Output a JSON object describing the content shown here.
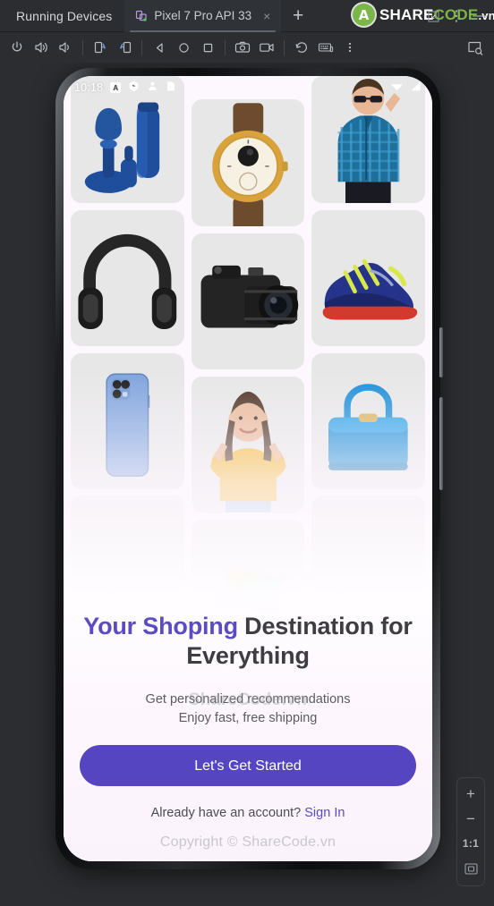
{
  "window": {
    "panel_title": "Running Devices",
    "tabs": [
      {
        "label": "Pixel 7 Pro API 33",
        "icon": "device-icon",
        "close": "×"
      }
    ],
    "new_tab_label": "+",
    "controls": {
      "collapse": "↙",
      "options": "⋮",
      "minimize": "—"
    },
    "watermark": {
      "logo_mark": "A",
      "logo_part1": "SHARE",
      "logo_part2": "CODE",
      "logo_part3": ".vn"
    }
  },
  "toolbar": {
    "buttons": [
      {
        "name": "power-button",
        "icon": "power-icon",
        "label": "Power"
      },
      {
        "name": "volume-up-button",
        "icon": "volume-up-icon",
        "label": "Volume Up"
      },
      {
        "name": "volume-down-button",
        "icon": "volume-down-icon",
        "label": "Volume Down"
      },
      {
        "name": "rotate-left-button",
        "icon": "rotate-left-icon",
        "label": "Rotate Left"
      },
      {
        "name": "rotate-right-button",
        "icon": "rotate-right-icon",
        "label": "Rotate Right"
      },
      {
        "name": "back-button",
        "icon": "back-triangle-icon",
        "label": "Back"
      },
      {
        "name": "home-button",
        "icon": "home-circle-icon",
        "label": "Home"
      },
      {
        "name": "overview-button",
        "icon": "overview-square-icon",
        "label": "Overview"
      },
      {
        "name": "screenshot-button",
        "icon": "camera-icon",
        "label": "Take Screenshot"
      },
      {
        "name": "record-button",
        "icon": "video-camera-icon",
        "label": "Record Screen"
      },
      {
        "name": "history-button",
        "icon": "undo-history-icon",
        "label": "Device History"
      },
      {
        "name": "keyboard-button",
        "icon": "keyboard-icon",
        "label": "Hardware Input"
      },
      {
        "name": "more-button",
        "icon": "more-vertical-icon",
        "label": "More"
      }
    ],
    "right_button": {
      "name": "display-mode-button",
      "icon": "screen-search-icon",
      "label": "Display Mode"
    }
  },
  "zoom_controls": {
    "zoom_in": "+",
    "zoom_out": "−",
    "actual_size": "1:1",
    "fit_to_screen": "fit-screen-icon"
  },
  "device": {
    "status_bar": {
      "time": "10:18",
      "icons": [
        "app-badge-icon",
        "shield-icon",
        "person-icon",
        "sdcard-icon"
      ],
      "right_icons": [
        "wifi-icon",
        "signal-icon"
      ]
    },
    "app": {
      "product_grid": {
        "columns": [
          {
            "items": [
              {
                "name": "grooming-set",
                "alt": "Blue grooming set"
              },
              {
                "name": "headphones",
                "alt": "Black over-ear headphones"
              },
              {
                "name": "smartphone",
                "alt": "Blue smartphone"
              },
              {
                "name": "placeholder-left",
                "alt": ""
              }
            ]
          },
          {
            "items": [
              {
                "name": "wristwatch",
                "alt": "Gold wristwatch"
              },
              {
                "name": "camera",
                "alt": "DSLR camera"
              },
              {
                "name": "woman-yellow-sweater",
                "alt": "Woman in yellow sweater"
              },
              {
                "name": "laptop",
                "alt": "Laptop with rainbow screen"
              }
            ]
          },
          {
            "items": [
              {
                "name": "man-plaid-shirt",
                "alt": "Man in blue plaid shirt"
              },
              {
                "name": "sneaker",
                "alt": "Blue running sneaker"
              },
              {
                "name": "handbag",
                "alt": "Blue handbag"
              },
              {
                "name": "placeholder-right",
                "alt": ""
              }
            ]
          }
        ]
      },
      "headline_accent": "Your Shoping",
      "headline_rest": " Destination for Everything",
      "subtitle_line1": "Get personalized recommendations",
      "subtitle_line2": "Enjoy fast, free shipping",
      "subtitle_watermark": "ShareCode.vn",
      "cta_label": "Let's Get Started",
      "signin_prompt": "Already have an account? ",
      "signin_link": "Sign In",
      "copyright": "Copyright © ShareCode.vn"
    }
  },
  "colors": {
    "accent_purple": "#5b4cc4",
    "cta_purple": "#5645c0",
    "app_background": "#fdf7fe",
    "ide_background": "#2b2d30",
    "brand_green": "#7ab648"
  }
}
